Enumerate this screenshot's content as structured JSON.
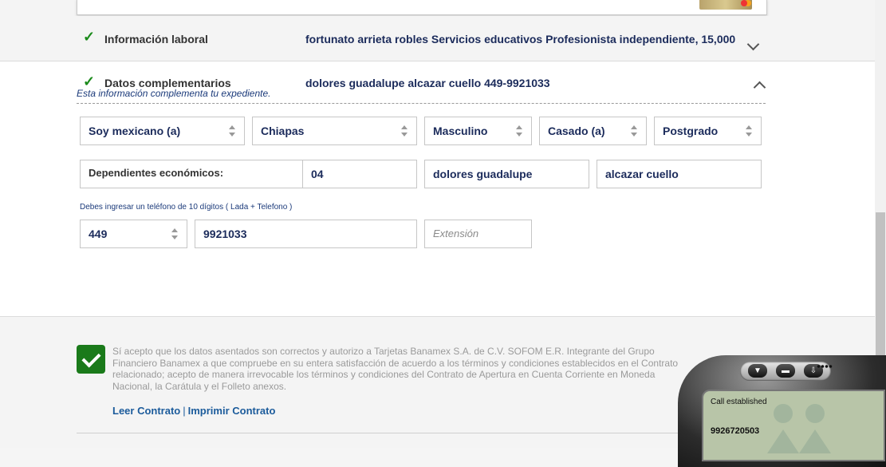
{
  "sections": {
    "laboral": {
      "label": "Información laboral",
      "summary": "fortunato arrieta robles Servicios educativos Profesionista independiente, 15,000"
    },
    "complementarios": {
      "label": "Datos complementarios",
      "summary": "dolores guadalupe alcazar cuello 449-9921033",
      "note": "Esta información complementa tu expediente."
    }
  },
  "form": {
    "nacionalidad": "Soy mexicano (a)",
    "estado": "Chiapas",
    "genero": "Masculino",
    "estado_civil": "Casado (a)",
    "escolaridad": "Postgrado",
    "dependientes_label": "Dependientes económicos:",
    "dependientes_value": "04",
    "nombre": "dolores guadalupe",
    "apellidos": "alcazar cuello",
    "phone_hint": "Debes ingresar un teléfono de 10 dígitos ( Lada + Telefono )",
    "lada": "449",
    "telefono": "9921033",
    "extension_placeholder": "Extensión"
  },
  "terms": {
    "text": "Sí acepto que los datos asentados son correctos y autorizo a Tarjetas Banamex S.A. de C.V. SOFOM E.R. Integrante del Grupo Financiero Banamex a que compruebe en su entera satisfacción de acuerdo a los términos y condiciones establecidos en el Contrato relacionado; acepto de manera irrevocable los términos y condiciones del Contrato de Apertura en Cuenta Corriente en Moneda Nacional, la Carátula y el Folleto anexos.",
    "link_read": "Leer Contrato",
    "separator": "|",
    "link_print": "Imprimir Contrato"
  },
  "softphone": {
    "status": "Call established",
    "number": "9926720503"
  },
  "colors": {
    "accent_green": "#1a7a1a",
    "text_navy": "#1b2b5b",
    "link_blue": "#1b5b9b"
  }
}
